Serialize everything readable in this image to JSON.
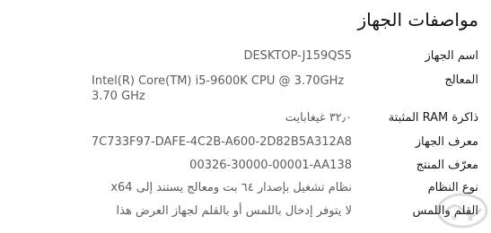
{
  "header": {
    "title": "مواصفات الجهاز"
  },
  "specs": [
    {
      "label": "اسم الجهاز",
      "value": "DESKTOP-J159QS5"
    },
    {
      "label": "المعالج",
      "value": "Intel(R) Core(TM) i5-9600K CPU @ 3.70GHz   3.70 GHz"
    },
    {
      "label": "ذاكرة RAM المثبتة",
      "value": "٣٢٫٠ غيغابايت"
    },
    {
      "label": "معرف الجهاز",
      "value": "7C733F97-DAFE-4C2B-A600-2D82B5A312A8"
    },
    {
      "label": "معرّف المنتج",
      "value": "00326-30000-00001-AA138"
    },
    {
      "label": "نوع النظام",
      "value": "نظام تشغيل بإصدار ٦٤ بت ومعالج يستند إلى x64"
    },
    {
      "label": "القلم واللمس",
      "value": "لا يتوفر إدخال باللمس أو بالقلم لجهاز العرض هذا"
    }
  ],
  "watermark": {
    "icon": "watermark-logo-icon"
  }
}
